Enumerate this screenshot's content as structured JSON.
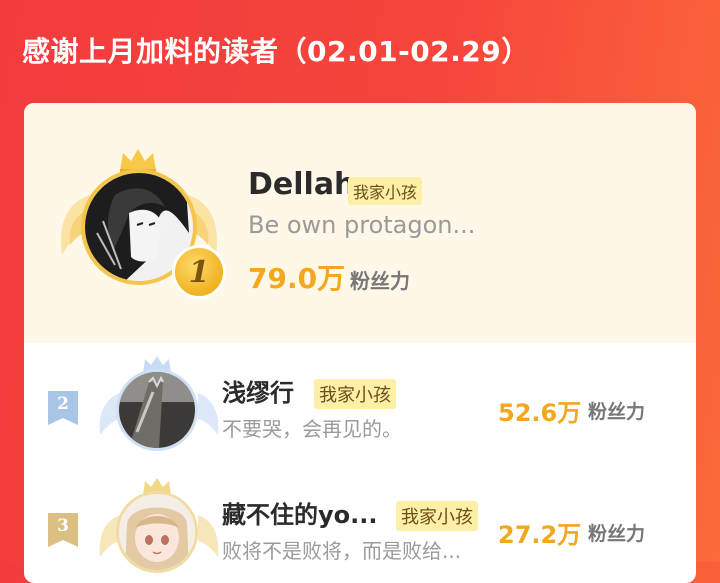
{
  "header": {
    "title": "感谢上月加料的读者（02.01-02.29）"
  },
  "colors": {
    "accent": "#f3a721",
    "tag_bg": "#fdf0a6",
    "background": "#f23b3d"
  },
  "readers": [
    {
      "rank": "1",
      "name": "Dellah",
      "tag": "我家小孩",
      "subtitle": "Be own protagon...",
      "score": "79.0万",
      "score_unit": "粉丝力",
      "avatar_icon": "avatar-illustration-icon"
    },
    {
      "rank": "2",
      "name": "浅缪行",
      "tag": "我家小孩",
      "subtitle": "不要哭，会再见的。",
      "score": "52.6万",
      "score_unit": "粉丝力",
      "avatar_icon": "avatar-photo-icon"
    },
    {
      "rank": "3",
      "name": "藏不住的yo...",
      "tag": "我家小孩",
      "subtitle": "败将不是败将，而是败给...",
      "score": "27.2万",
      "score_unit": "粉丝力",
      "avatar_icon": "avatar-anime-icon"
    }
  ]
}
